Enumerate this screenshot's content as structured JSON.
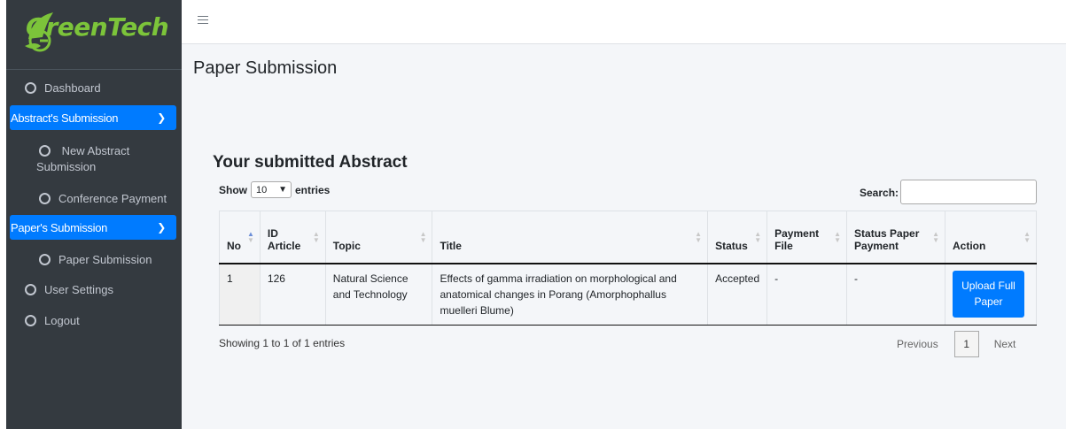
{
  "brand": {
    "name": "GreenTech",
    "accent": "#7cc43a"
  },
  "sidebar": {
    "items": [
      {
        "label": "Dashboard",
        "icon": "circle-icon"
      },
      {
        "label": "Abstract's Submission",
        "icon": "chevron-down-icon"
      },
      {
        "label": "New Abstract Submission",
        "icon": "circle-icon"
      },
      {
        "label": "Conference Payment",
        "icon": "circle-icon"
      },
      {
        "label": "Paper's Submission",
        "icon": "chevron-down-icon"
      },
      {
        "label": "Paper Submission",
        "icon": "circle-icon"
      },
      {
        "label": "User Settings",
        "icon": "circle-icon"
      },
      {
        "label": "Logout",
        "icon": "circle-icon"
      }
    ],
    "active_color": "#007bff"
  },
  "header": {
    "menu_icon": "hamburger-icon"
  },
  "main": {
    "page_title": "Paper Submission",
    "section_title": "Your submitted Abstract",
    "length_prefix": "Show",
    "length_value": "10",
    "length_suffix": "entries",
    "search_label": "Search:",
    "search_value": "",
    "table": {
      "columns": [
        "No",
        "ID Article",
        "Topic",
        "Title",
        "Status",
        "Payment File",
        "Status Paper Payment",
        "Action"
      ],
      "rows": [
        {
          "no": "1",
          "id_article": "126",
          "topic": "Natural Science and Technology",
          "title": "Effects of gamma irradiation on morphological and anatomical changes in Porang (Amorphophallus muelleri Blume)",
          "status": "Accepted",
          "payment_file": "-",
          "status_paper_payment": "-",
          "action": "Upload Full Paper"
        }
      ]
    },
    "info": "Showing 1 to 1 of 1 entries",
    "pagination": {
      "previous": "Previous",
      "page": "1",
      "next": "Next"
    }
  }
}
